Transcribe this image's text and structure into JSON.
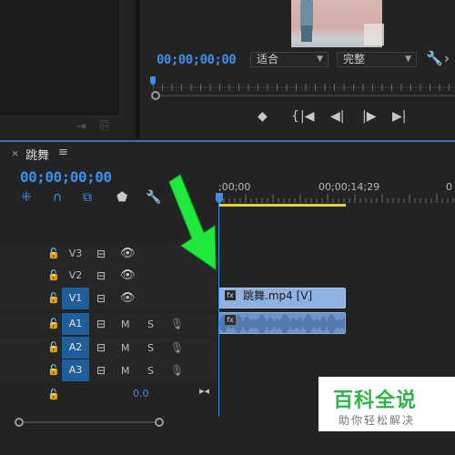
{
  "program_monitor": {
    "timecode": "00;00;00;00",
    "fit_value": "适合",
    "quality_value": "完整"
  },
  "timeline": {
    "tab_title": "跳舞",
    "tab_close": "×",
    "tab_menu": "≡",
    "timecode": "00;00;00;00",
    "ruler": {
      "start": ";00;00",
      "mid": "00;00;14;29",
      "end": "0"
    },
    "video_tracks": [
      {
        "label": "V3",
        "active": false
      },
      {
        "label": "V2",
        "active": false
      },
      {
        "label": "V1",
        "active": true
      }
    ],
    "audio_tracks": [
      {
        "label": "A1",
        "active": true,
        "mute": "M",
        "solo": "S"
      },
      {
        "label": "A2",
        "active": true,
        "mute": "M",
        "solo": "S"
      },
      {
        "label": "A3",
        "active": true,
        "mute": "M",
        "solo": "S"
      }
    ],
    "master_volume": "0.0",
    "clip_video_label": "跳舞.mp4 [V]",
    "clip_fx": "fx"
  },
  "watermark": {
    "title": "百科全说",
    "subtitle": "助你轻松解决"
  },
  "colors": {
    "accent_blue": "#3d8ee8",
    "work_area_yellow": "#e6d23b",
    "clip_video": "#8fb2e3",
    "clip_audio": "#6e93c8",
    "arrow_green": "#21e83c",
    "watermark_green": "#2fb34a"
  }
}
